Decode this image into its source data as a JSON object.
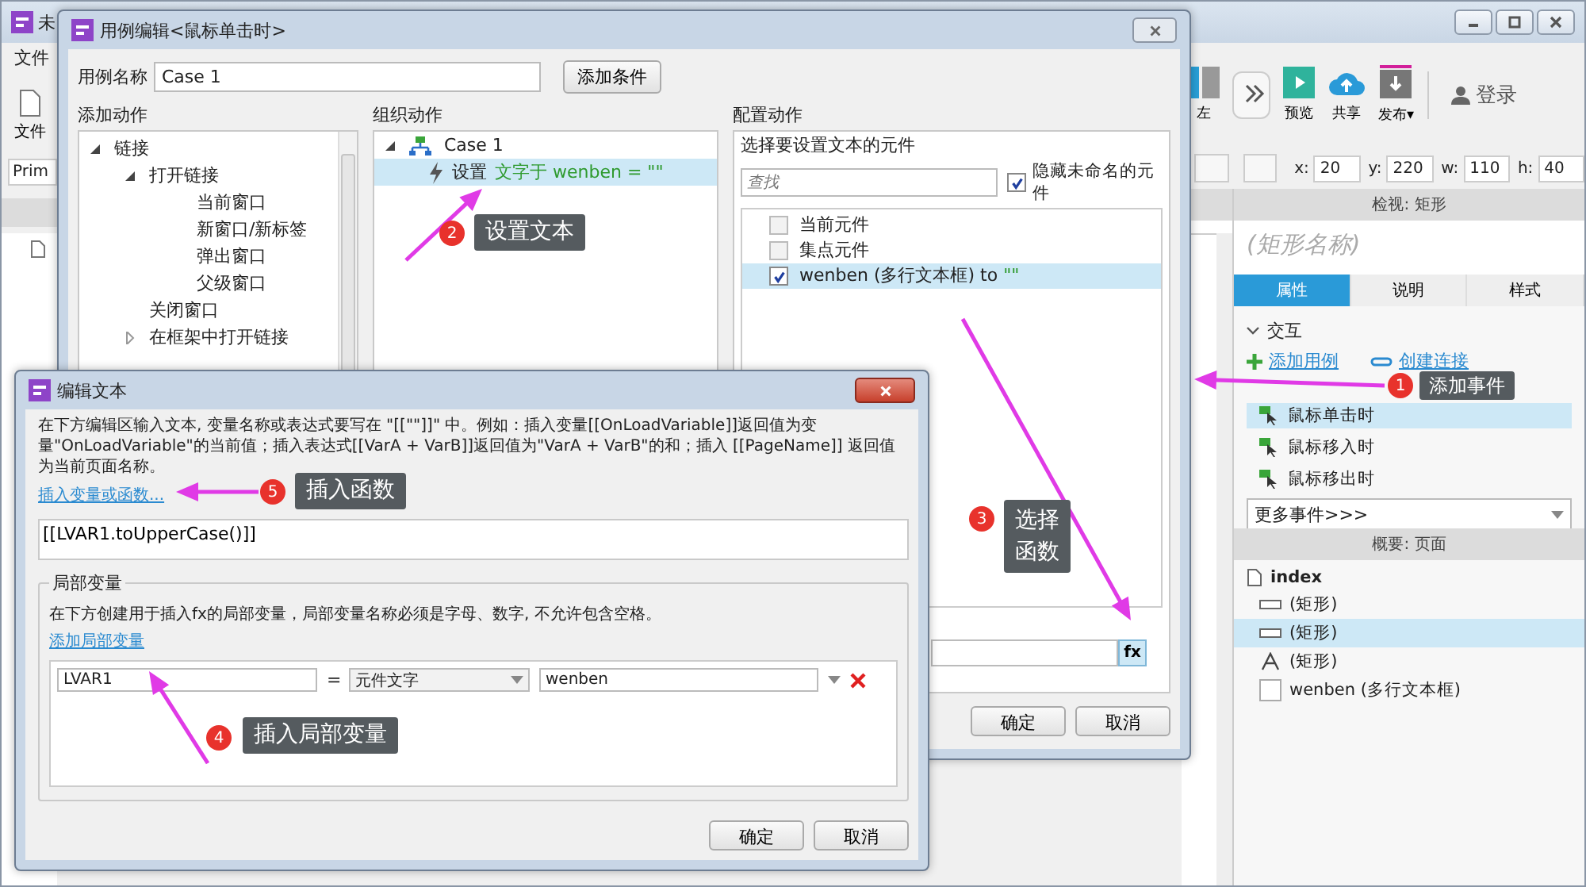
{
  "app": {
    "title": "未",
    "menu": [
      "文件"
    ],
    "file_button": "文件",
    "style_field": "Prim",
    "toolbar": [
      {
        "label": "左",
        "kind": "align"
      },
      {
        "label": "预览",
        "kind": "preview"
      },
      {
        "label": "共享",
        "kind": "share"
      },
      {
        "label": "发布▾",
        "kind": "publish"
      }
    ],
    "login": "登录",
    "geometry": [
      {
        "label": "x:",
        "value": "20"
      },
      {
        "label": "y:",
        "value": "220"
      },
      {
        "label": "w:",
        "value": "110"
      },
      {
        "label": "h:",
        "value": "40"
      }
    ],
    "inspector": {
      "title": "检视: 矩形",
      "name_placeholder": "(矩形名称)",
      "tabs": [
        {
          "label": "属性",
          "selected": true
        },
        {
          "label": "说明",
          "selected": false
        },
        {
          "label": "样式",
          "selected": false
        }
      ],
      "section": "交互",
      "add_case": "添加用例",
      "create_link": "创建连接",
      "events": [
        {
          "label": "鼠标单击时",
          "selected": true
        },
        {
          "label": "鼠标移入时",
          "selected": false
        },
        {
          "label": "鼠标移出时",
          "selected": false
        }
      ],
      "more_events": "更多事件>>>"
    },
    "outline": {
      "title": "概要: 页面",
      "items": [
        {
          "label": "index",
          "kind": "page",
          "selected": false
        },
        {
          "label": "(矩形)",
          "kind": "rect",
          "selected": false
        },
        {
          "label": "(矩形)",
          "kind": "rect",
          "selected": true
        },
        {
          "label": "(矩形)",
          "kind": "text",
          "selected": false
        },
        {
          "label": "wenben (多行文本框)",
          "kind": "textarea",
          "selected": false
        }
      ]
    }
  },
  "case_editor": {
    "title": "用例编辑<鼠标单击时>",
    "case_name_label": "用例名称",
    "case_name": "Case 1",
    "add_condition": "添加条件",
    "add_actions": {
      "title": "添加动作",
      "items": [
        {
          "label": "链接",
          "expanded": true,
          "children": [
            {
              "label": "打开链接",
              "expanded": true,
              "children": [
                {
                  "label": "当前窗口"
                },
                {
                  "label": "新窗口/新标签"
                },
                {
                  "label": "弹出窗口"
                },
                {
                  "label": "父级窗口"
                }
              ]
            },
            {
              "label": "关闭窗口"
            },
            {
              "label": "在框架中打开链接",
              "expanded": false
            }
          ]
        }
      ]
    },
    "organize": {
      "title": "组织动作",
      "case": "Case 1",
      "case_expanded": true,
      "actions": [
        {
          "verb": "设置",
          "detail": "文字于 wenben = \"\"",
          "selected": true
        }
      ]
    },
    "configure": {
      "title": "配置动作",
      "subtitle": "选择要设置文本的元件",
      "search_placeholder": "查找",
      "hide_unnamed": {
        "label": "隐藏未命名的元件",
        "checked": true
      },
      "widgets": [
        {
          "label": "当前元件",
          "checked": false,
          "selected": false
        },
        {
          "label": "集点元件",
          "checked": false,
          "selected": false
        },
        {
          "label": "wenben (多行文本框) to",
          "value": "\"\"",
          "checked": true,
          "selected": true
        }
      ],
      "fx": "fx"
    },
    "ok": "确定",
    "cancel": "取消"
  },
  "edit_text": {
    "title": "编辑文本",
    "description": "在下方编辑区输入文本, 变量名称或表达式要写在 \"[[\"\"]]\" 中。例如：插入变量[[OnLoadVariable]]返回值为变量\"OnLoadVariable\"的当前值；插入表达式[[VarA + VarB]]返回值为\"VarA + VarB\"的和；插入 [[PageName]] 返回值为当前页面名称。",
    "insert_link": "插入变量或函数...",
    "expression": "[[LVAR1.toUpperCase()]]",
    "locals": {
      "title": "局部变量",
      "description": "在下方创建用于插入fx的局部变量，局部变量名称必须是字母、数字, 不允许包含空格。",
      "add_link": "添加局部变量",
      "rows": [
        {
          "name": "LVAR1",
          "op": "=",
          "type": "元件文字",
          "target": "wenben"
        }
      ]
    },
    "ok": "确定",
    "cancel": "取消"
  },
  "callouts": [
    {
      "number": "2",
      "text": "设置文本"
    },
    {
      "number": "1",
      "text": "添加事件"
    },
    {
      "number": "5",
      "text": "插入函数"
    },
    {
      "number": "3",
      "text": "选择函数"
    },
    {
      "number": "4",
      "text": "插入局部变量"
    }
  ]
}
